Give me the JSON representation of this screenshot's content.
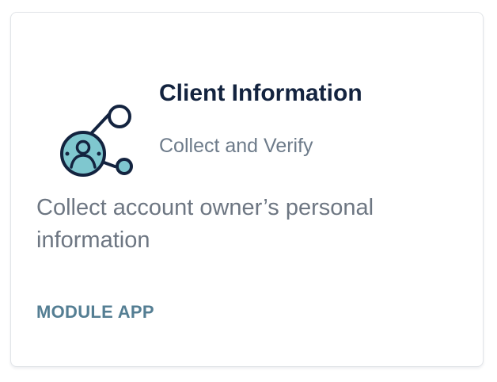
{
  "card": {
    "title": "Client Information",
    "subtitle": "Collect and Verify",
    "description": "Collect account owner’s personal information",
    "link_label": "MODULE APP",
    "icon": "user-network-icon"
  },
  "colors": {
    "title": "#13233f",
    "subtitle": "#6d7b8a",
    "link": "#547e93",
    "icon_fill": "#7fc7cf",
    "icon_stroke": "#13233f"
  }
}
